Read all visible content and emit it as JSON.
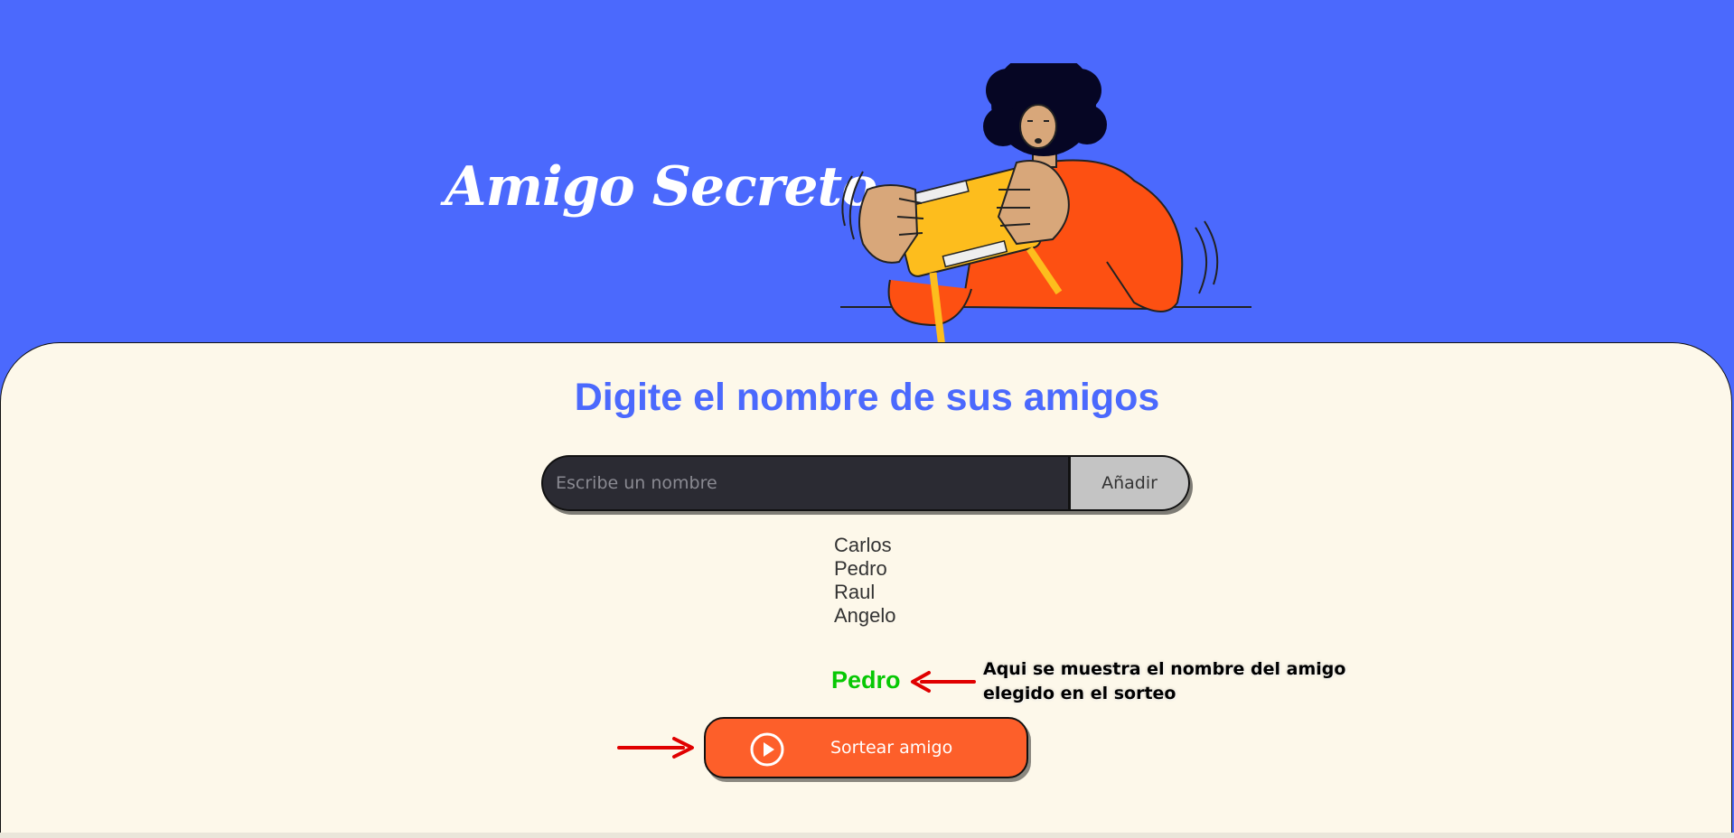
{
  "header": {
    "title": "Amigo Secreto"
  },
  "main": {
    "subtitle": "Digite el nombre de sus amigos",
    "input": {
      "value": "",
      "placeholder": "Escribe un nombre"
    },
    "add_button_label": "Añadir",
    "friends": [
      "Carlos",
      "Pedro",
      "Raul",
      "Angelo"
    ],
    "result": "Pedro",
    "annotation_text": "Aqui se muestra el nombre del amigo elegido en el sorteo",
    "draw_button_label": "Sortear amigo"
  },
  "icons": {
    "illustration": "person-holding-gift-illustration",
    "play": "play-circle-icon",
    "arrows": "red-arrow-icon"
  },
  "colors": {
    "header_bg": "#4b69fd",
    "panel_bg": "#fdf8ea",
    "accent_blue": "#4b69fd",
    "input_bg": "#2b2b33",
    "add_button_bg": "#c4c4c4",
    "draw_button_bg": "#fd5f2a",
    "result_green": "#07c804",
    "arrow_red": "#e00000"
  }
}
